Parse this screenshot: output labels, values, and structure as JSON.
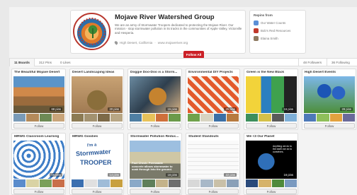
{
  "profile": {
    "name": "Mojave River Watershed Group",
    "description": "We are an army of Stormwater Troopers dedicated to protecting the Mojave River. Our mission - stop stormwater pollution in its tracks in the communities of Apple Valley, Victorville and Hesperia.",
    "location": "High Desert, California",
    "website": "www.mojaveriver.org",
    "separator": "·"
  },
  "repins": {
    "title": "Repins from",
    "items": [
      {
        "name": "Our Water Counts",
        "color": "#5b8fd6"
      },
      {
        "name": "Bob's Red Resources",
        "color": "#c0392b"
      },
      {
        "name": "Elaina Smith",
        "color": "#8e7a60"
      }
    ]
  },
  "stats": {
    "boards": "11 Boards",
    "pins": "312 Pins",
    "likes": "0 Likes",
    "follow_all": "Follow All",
    "followers": "48 Followers",
    "following": "36 Following"
  },
  "boards": [
    {
      "title": "The Beautiful Mojave Desert",
      "pins": "68 pins",
      "cover": "c-desert",
      "thumbs": [
        "#7a9bb8",
        "#b48a5a",
        "#6d8a55",
        "#c9a57a"
      ]
    },
    {
      "title": "Desert Landscaping Ideas",
      "pins": "20 pins",
      "cover": "c-landscape",
      "thumbs": [
        "#8c7b54",
        "#a39270",
        "#7d6a48",
        "#b8a684"
      ]
    },
    {
      "title": "Doggie Doo-Doo is a Storm...",
      "pins": "15 pins",
      "cover": "c-dog",
      "thumbs": [
        "#4f7fa3",
        "#e8c25a",
        "#cf6f3a",
        "#6b9a4a"
      ]
    },
    {
      "title": "Environmental DIY Projects",
      "pins": "25 pins",
      "cover": "c-diy",
      "thumbs": [
        "#6fa24b",
        "#d8d4c2",
        "#3b6fa6",
        "#b77a3f"
      ]
    },
    {
      "title": "Green is the New Black",
      "pins": "16 pins",
      "cover": "c-green",
      "thumbs": [
        "#3c8f5c",
        "#d4c048",
        "#5a5a5a",
        "#7fb0d8"
      ]
    },
    {
      "title": "High Desert Events",
      "pins": "28 pins",
      "cover": "c-events",
      "thumbs": [
        "#4d79b8",
        "#8fbf5a",
        "#e2a23f",
        "#6a6a9a"
      ]
    },
    {
      "title": "MRWG Classroom Learning",
      "pins": "25 pins",
      "cover": "c-classroom",
      "thumbs": [
        "#5a8ccc",
        "#d9d3a4",
        "#7aa05a",
        "#c96f4a"
      ]
    },
    {
      "title": "MRWG Goodies",
      "pins": "14 pins",
      "cover": "c-guides",
      "thumbs": [
        "#3b6fb0",
        "#e0e0e0",
        "#9fbcd8",
        "#c8a040"
      ]
    },
    {
      "title": "Stormwater Pollution Reduc...",
      "pins": "16 pins",
      "cover": "c-stormwater",
      "thumbs": [
        "#8aa9c8",
        "#5f7f5a",
        "#c4b38a",
        "#6d6d6d"
      ]
    },
    {
      "title": "Student Standouts",
      "pins": "22 pins",
      "cover": "c-student",
      "thumbs": [
        "#d8d8d8",
        "#a8b8c8",
        "#c9c0a8",
        "#8aa0b8"
      ]
    },
    {
      "title": "We <3 Our Planet",
      "pins": "16 pins",
      "cover": "c-planet",
      "thumbs": [
        "#2a4a7a",
        "#d6b36a",
        "#4f8a3a",
        "#7a9ac0"
      ]
    }
  ],
  "cover_text": {
    "guides_line1": "I'm a",
    "guides_line2": "Stormwater",
    "guides_line3": "TROOPER",
    "stormwater_fact": "Fact Check: Permeable concrete allows stormwater to soak through into the ground.",
    "planet_quote": "Anything we do to the earth we do to ourselves."
  },
  "follow_label": "Follow"
}
